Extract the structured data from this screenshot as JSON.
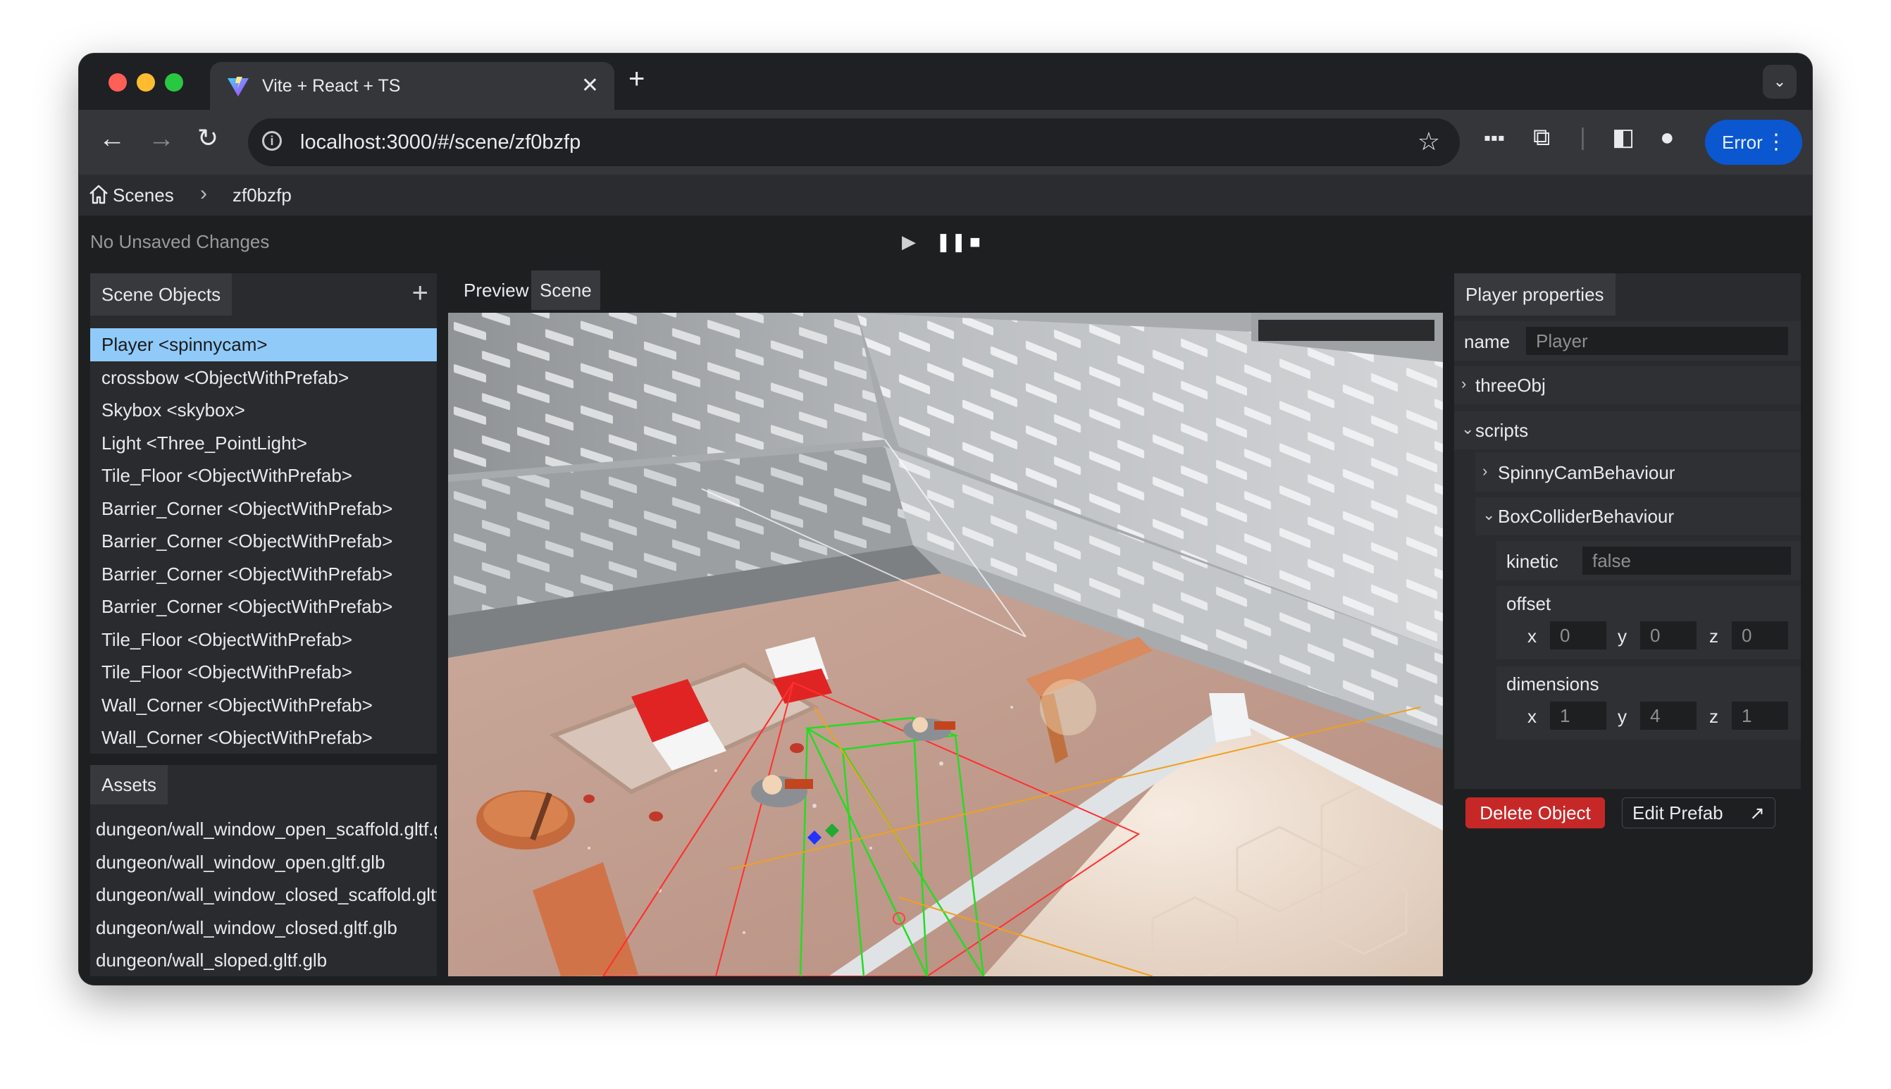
{
  "browser": {
    "tab_title": "Vite + React + TS",
    "url": "localhost:3000/#/scene/zf0bzfp",
    "profile_label": "Error"
  },
  "breadcrumb": {
    "root": "Scenes",
    "current": "zf0bzfp"
  },
  "status": {
    "text": "No Unsaved Changes"
  },
  "scene_objects": {
    "title": "Scene Objects",
    "items": [
      "Player <spinnycam>",
      "crossbow <ObjectWithPrefab>",
      "Skybox <skybox>",
      "Light <Three_PointLight>",
      "Tile_Floor <ObjectWithPrefab>",
      "Barrier_Corner <ObjectWithPrefab>",
      "Barrier_Corner <ObjectWithPrefab>",
      "Barrier_Corner <ObjectWithPrefab>",
      "Barrier_Corner <ObjectWithPrefab>",
      "Tile_Floor <ObjectWithPrefab>",
      "Tile_Floor <ObjectWithPrefab>",
      "Wall_Corner <ObjectWithPrefab>",
      "Wall_Corner <ObjectWithPrefab>"
    ]
  },
  "assets": {
    "title": "Assets",
    "items": [
      "dungeon/wall_window_open_scaffold.gltf.glb",
      "dungeon/wall_window_open.gltf.glb",
      "dungeon/wall_window_closed_scaffold.gltf.glb",
      "dungeon/wall_window_closed.gltf.glb",
      "dungeon/wall_sloped.gltf.glb"
    ]
  },
  "view_tabs": {
    "preview": "Preview",
    "scene": "Scene"
  },
  "properties": {
    "title": "Player properties",
    "name_label": "name",
    "name_placeholder": "Player",
    "threeObj_label": "threeObj",
    "scripts_label": "scripts",
    "spinny_label": "SpinnyCamBehaviour",
    "box_label": "BoxColliderBehaviour",
    "kinetic_label": "kinetic",
    "kinetic_placeholder": "false",
    "offset_label": "offset",
    "offset": {
      "x_label": "x",
      "y_label": "y",
      "z_label": "z",
      "x": "0",
      "y": "0",
      "z": "0"
    },
    "dimensions_label": "dimensions",
    "dimensions": {
      "x_label": "x",
      "y_label": "y",
      "z_label": "z",
      "x": "1",
      "y": "4",
      "z": "1"
    }
  },
  "actions": {
    "delete": "Delete Object",
    "edit_prefab": "Edit Prefab"
  },
  "colors": {
    "selected": "#90caf9",
    "delete": "#c62828",
    "profile": "#0b57d0"
  }
}
